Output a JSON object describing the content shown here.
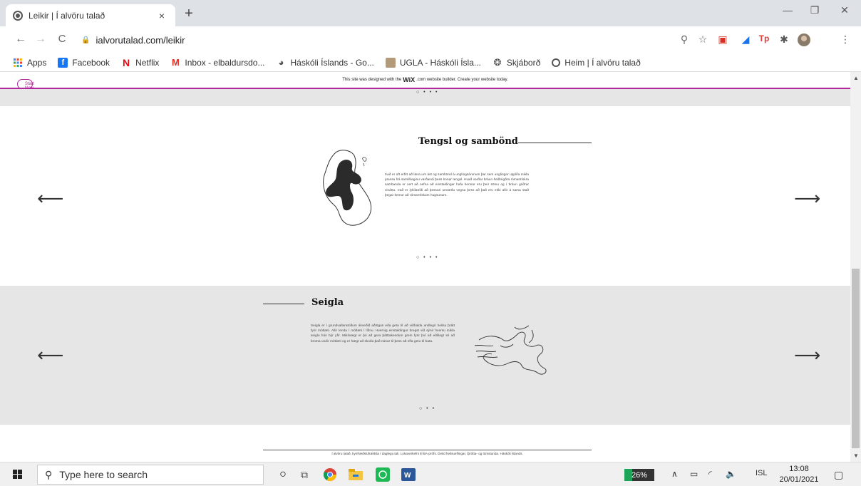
{
  "browser": {
    "tab_title": "Leikir | Í alvöru talað",
    "tab_close": "×",
    "new_tab": "+",
    "url": "ialvorutalad.com/leikir",
    "window_controls": {
      "minimize": "—",
      "restore": "❐",
      "close": "✕"
    },
    "nav": {
      "back": "←",
      "forward": "→",
      "reload": "C"
    }
  },
  "bookmarks": [
    {
      "label": "Apps",
      "icon": "apps-grid-icon"
    },
    {
      "label": "Facebook",
      "icon": "facebook-icon"
    },
    {
      "label": "Netflix",
      "icon": "netflix-icon"
    },
    {
      "label": "Inbox - elbaldursdo...",
      "icon": "gmail-icon"
    },
    {
      "label": "Háskóli Íslands - Go...",
      "icon": "globe-icon"
    },
    {
      "label": "UGLA - Háskóli Ísla...",
      "icon": "ugla-icon"
    },
    {
      "label": "Skjáborð",
      "icon": "skjabord-icon"
    },
    {
      "label": "Heim | Í alvöru talað",
      "icon": "site-icon"
    }
  ],
  "wix_banner": {
    "pre": "This site was designed with the",
    "brand": "WiX",
    "post": ".com website builder. Create your website today.",
    "button": "Start Now"
  },
  "slider_dots": "○ • • •",
  "slider_dots_short": "○ • •",
  "section1": {
    "title": "Tengsl og sambönd",
    "body": "Það er oft erfitt að læra um ást og sambönd á unglingsárunum þar sem unglingar upplifa mikla pressu frá samfélaginu varðandi þess konar tengsl. Hvað varðar bráun heilbrigðra rómantískra sambanda er vert að nefna að einstaklingar hafa hennar eru þeir sömu og í bráun góðrar vináttu. Það er lykilatriði að þessari umræðu vegna þess að það eru ekki allir á sama stað þegar kemur að rómantískum hugsunum.",
    "prev": "⟵",
    "next": "⟶"
  },
  "section2": {
    "title": "Seigla",
    "body": "Seigla er í grundvallaratriðum ákveðið aðlögun eða geta til að viðhalda andlegri heilsu þrátt fyrir mótlæti. Allir lenda í mótlæti í lífinu. Hvernig einstaklingur bregst við sýnir hversu mikla seiglu hún býr yfir. Mikilvægt er þó að gera þátttakendum grein fyrir því að eðlilegt sé að brotna undir mótlæti og er hægt að skoða það nánar til þess að efla getu til bata.",
    "prev": "⟵",
    "next": "⟶"
  },
  "footer": {
    "text": "Í alvöru talað, kynfræðslufræðsla í daglegu tali. Lokaverkefni til BA-prófs. Deild heilsueflingar, íþrótta- og tómstunda. Háskóli Íslands."
  },
  "taskbar": {
    "search_placeholder": "Type here to search",
    "battery_text": "26%",
    "battery_level": 0.26,
    "language": "ISL",
    "time": "13:08",
    "date": "20/01/2021"
  },
  "colors": {
    "wix_accent": "#b2279b",
    "section_gray": "#e6e6e6"
  }
}
